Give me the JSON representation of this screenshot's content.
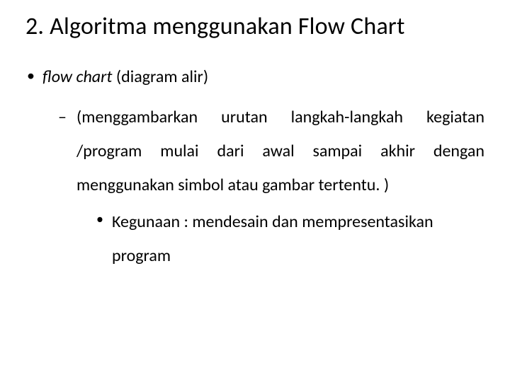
{
  "slide": {
    "title": "2. Algoritma menggunakan Flow Chart",
    "bullet1": {
      "italic_part": "flow chart",
      "rest": " (diagram alir)",
      "sub": {
        "text": "(menggambarkan urutan langkah-langkah kegiatan /program mulai dari awal sampai akhir dengan menggunakan simbol atau gambar tertentu. )",
        "sub": {
          "text": "Kegunaan : mendesain dan mempresentasikan program"
        }
      }
    }
  }
}
